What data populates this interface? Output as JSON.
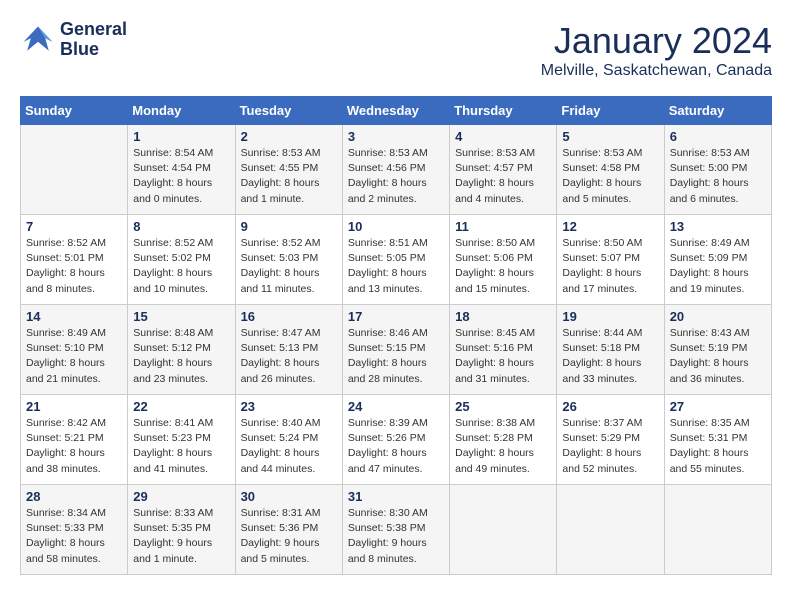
{
  "header": {
    "logo_line1": "General",
    "logo_line2": "Blue",
    "month_year": "January 2024",
    "location": "Melville, Saskatchewan, Canada"
  },
  "days_of_week": [
    "Sunday",
    "Monday",
    "Tuesday",
    "Wednesday",
    "Thursday",
    "Friday",
    "Saturday"
  ],
  "weeks": [
    [
      {
        "day": "",
        "sunrise": "",
        "sunset": "",
        "daylight": ""
      },
      {
        "day": "1",
        "sunrise": "Sunrise: 8:54 AM",
        "sunset": "Sunset: 4:54 PM",
        "daylight": "Daylight: 8 hours and 0 minutes."
      },
      {
        "day": "2",
        "sunrise": "Sunrise: 8:53 AM",
        "sunset": "Sunset: 4:55 PM",
        "daylight": "Daylight: 8 hours and 1 minute."
      },
      {
        "day": "3",
        "sunrise": "Sunrise: 8:53 AM",
        "sunset": "Sunset: 4:56 PM",
        "daylight": "Daylight: 8 hours and 2 minutes."
      },
      {
        "day": "4",
        "sunrise": "Sunrise: 8:53 AM",
        "sunset": "Sunset: 4:57 PM",
        "daylight": "Daylight: 8 hours and 4 minutes."
      },
      {
        "day": "5",
        "sunrise": "Sunrise: 8:53 AM",
        "sunset": "Sunset: 4:58 PM",
        "daylight": "Daylight: 8 hours and 5 minutes."
      },
      {
        "day": "6",
        "sunrise": "Sunrise: 8:53 AM",
        "sunset": "Sunset: 5:00 PM",
        "daylight": "Daylight: 8 hours and 6 minutes."
      }
    ],
    [
      {
        "day": "7",
        "sunrise": "Sunrise: 8:52 AM",
        "sunset": "Sunset: 5:01 PM",
        "daylight": "Daylight: 8 hours and 8 minutes."
      },
      {
        "day": "8",
        "sunrise": "Sunrise: 8:52 AM",
        "sunset": "Sunset: 5:02 PM",
        "daylight": "Daylight: 8 hours and 10 minutes."
      },
      {
        "day": "9",
        "sunrise": "Sunrise: 8:52 AM",
        "sunset": "Sunset: 5:03 PM",
        "daylight": "Daylight: 8 hours and 11 minutes."
      },
      {
        "day": "10",
        "sunrise": "Sunrise: 8:51 AM",
        "sunset": "Sunset: 5:05 PM",
        "daylight": "Daylight: 8 hours and 13 minutes."
      },
      {
        "day": "11",
        "sunrise": "Sunrise: 8:50 AM",
        "sunset": "Sunset: 5:06 PM",
        "daylight": "Daylight: 8 hours and 15 minutes."
      },
      {
        "day": "12",
        "sunrise": "Sunrise: 8:50 AM",
        "sunset": "Sunset: 5:07 PM",
        "daylight": "Daylight: 8 hours and 17 minutes."
      },
      {
        "day": "13",
        "sunrise": "Sunrise: 8:49 AM",
        "sunset": "Sunset: 5:09 PM",
        "daylight": "Daylight: 8 hours and 19 minutes."
      }
    ],
    [
      {
        "day": "14",
        "sunrise": "Sunrise: 8:49 AM",
        "sunset": "Sunset: 5:10 PM",
        "daylight": "Daylight: 8 hours and 21 minutes."
      },
      {
        "day": "15",
        "sunrise": "Sunrise: 8:48 AM",
        "sunset": "Sunset: 5:12 PM",
        "daylight": "Daylight: 8 hours and 23 minutes."
      },
      {
        "day": "16",
        "sunrise": "Sunrise: 8:47 AM",
        "sunset": "Sunset: 5:13 PM",
        "daylight": "Daylight: 8 hours and 26 minutes."
      },
      {
        "day": "17",
        "sunrise": "Sunrise: 8:46 AM",
        "sunset": "Sunset: 5:15 PM",
        "daylight": "Daylight: 8 hours and 28 minutes."
      },
      {
        "day": "18",
        "sunrise": "Sunrise: 8:45 AM",
        "sunset": "Sunset: 5:16 PM",
        "daylight": "Daylight: 8 hours and 31 minutes."
      },
      {
        "day": "19",
        "sunrise": "Sunrise: 8:44 AM",
        "sunset": "Sunset: 5:18 PM",
        "daylight": "Daylight: 8 hours and 33 minutes."
      },
      {
        "day": "20",
        "sunrise": "Sunrise: 8:43 AM",
        "sunset": "Sunset: 5:19 PM",
        "daylight": "Daylight: 8 hours and 36 minutes."
      }
    ],
    [
      {
        "day": "21",
        "sunrise": "Sunrise: 8:42 AM",
        "sunset": "Sunset: 5:21 PM",
        "daylight": "Daylight: 8 hours and 38 minutes."
      },
      {
        "day": "22",
        "sunrise": "Sunrise: 8:41 AM",
        "sunset": "Sunset: 5:23 PM",
        "daylight": "Daylight: 8 hours and 41 minutes."
      },
      {
        "day": "23",
        "sunrise": "Sunrise: 8:40 AM",
        "sunset": "Sunset: 5:24 PM",
        "daylight": "Daylight: 8 hours and 44 minutes."
      },
      {
        "day": "24",
        "sunrise": "Sunrise: 8:39 AM",
        "sunset": "Sunset: 5:26 PM",
        "daylight": "Daylight: 8 hours and 47 minutes."
      },
      {
        "day": "25",
        "sunrise": "Sunrise: 8:38 AM",
        "sunset": "Sunset: 5:28 PM",
        "daylight": "Daylight: 8 hours and 49 minutes."
      },
      {
        "day": "26",
        "sunrise": "Sunrise: 8:37 AM",
        "sunset": "Sunset: 5:29 PM",
        "daylight": "Daylight: 8 hours and 52 minutes."
      },
      {
        "day": "27",
        "sunrise": "Sunrise: 8:35 AM",
        "sunset": "Sunset: 5:31 PM",
        "daylight": "Daylight: 8 hours and 55 minutes."
      }
    ],
    [
      {
        "day": "28",
        "sunrise": "Sunrise: 8:34 AM",
        "sunset": "Sunset: 5:33 PM",
        "daylight": "Daylight: 8 hours and 58 minutes."
      },
      {
        "day": "29",
        "sunrise": "Sunrise: 8:33 AM",
        "sunset": "Sunset: 5:35 PM",
        "daylight": "Daylight: 9 hours and 1 minute."
      },
      {
        "day": "30",
        "sunrise": "Sunrise: 8:31 AM",
        "sunset": "Sunset: 5:36 PM",
        "daylight": "Daylight: 9 hours and 5 minutes."
      },
      {
        "day": "31",
        "sunrise": "Sunrise: 8:30 AM",
        "sunset": "Sunset: 5:38 PM",
        "daylight": "Daylight: 9 hours and 8 minutes."
      },
      {
        "day": "",
        "sunrise": "",
        "sunset": "",
        "daylight": ""
      },
      {
        "day": "",
        "sunrise": "",
        "sunset": "",
        "daylight": ""
      },
      {
        "day": "",
        "sunrise": "",
        "sunset": "",
        "daylight": ""
      }
    ]
  ]
}
